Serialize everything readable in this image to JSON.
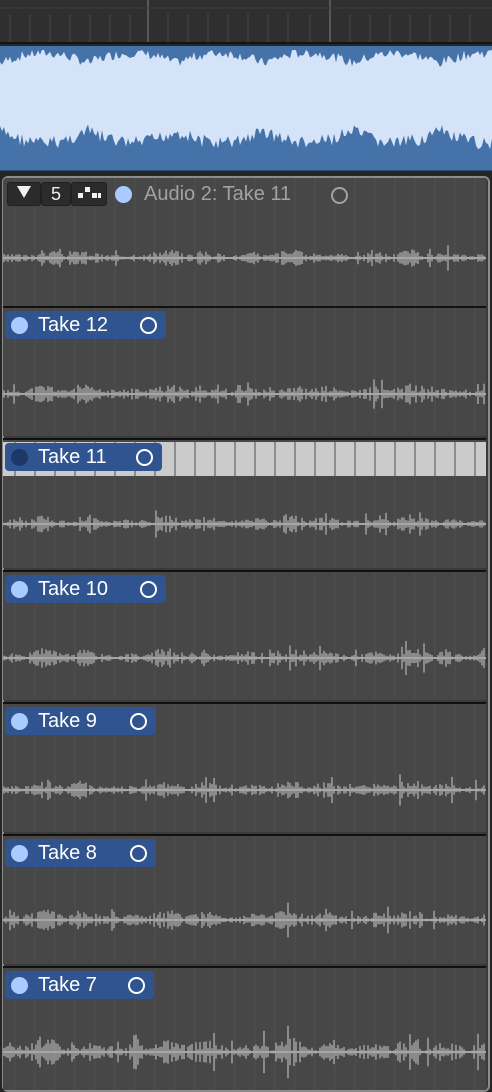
{
  "colors": {
    "take_region": "#2f5490",
    "take_dot": "#a9cbff",
    "take_dot_selected": "#1e3766",
    "lane_bg": "#474747",
    "comp_region_bg": "#4572a9",
    "comp_wave": "#d4e3f8",
    "take_wave": "#a6a6a6"
  },
  "take_folder": {
    "disclosure_icon": "triangle-down-icon",
    "take_count": "5",
    "quick_swipe_icon": "quick-swipe-comping-icon",
    "title": "Audio 2: Take 11"
  },
  "takes": [
    {
      "label": "Take 12",
      "selected": false
    },
    {
      "label": "Take 11",
      "selected": true
    },
    {
      "label": "Take 10",
      "selected": false
    },
    {
      "label": "Take 9",
      "selected": false
    },
    {
      "label": "Take 8",
      "selected": false
    },
    {
      "label": "Take 7",
      "selected": false
    }
  ]
}
